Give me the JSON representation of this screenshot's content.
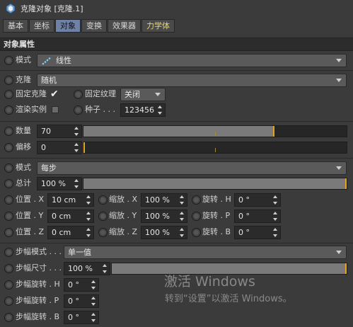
{
  "window": {
    "title": "克隆对象 [克隆.1]"
  },
  "tabs": [
    {
      "label": "基本"
    },
    {
      "label": "坐标"
    },
    {
      "label": "对象"
    },
    {
      "label": "变换"
    },
    {
      "label": "效果器"
    },
    {
      "label": "力学体"
    }
  ],
  "section_title": "对象属性",
  "mode": {
    "label": "模式",
    "value": "线性"
  },
  "clone": {
    "label": "克隆",
    "value": "随机"
  },
  "fixed_clone": {
    "label": "固定克隆",
    "checked": true
  },
  "fixed_texture": {
    "label": "固定纹理",
    "value": "关闭"
  },
  "render_instance": {
    "label": "渲染实例",
    "checked": false
  },
  "seed": {
    "label": "种子 . . .",
    "value": "123456"
  },
  "count": {
    "label": "数量",
    "value": "70",
    "fraction": 0.72
  },
  "offset": {
    "label": "偏移",
    "value": "0",
    "fraction": 0.0
  },
  "mode2": {
    "label": "模式",
    "value": "每步"
  },
  "total": {
    "label": "总计",
    "value": "100 %",
    "fraction": 1.0
  },
  "position": {
    "x": {
      "label": "位置 . X",
      "value": "10 cm"
    },
    "y": {
      "label": "位置 . Y",
      "value": "0 cm"
    },
    "z": {
      "label": "位置 . Z",
      "value": "0 cm"
    }
  },
  "scale": {
    "x": {
      "label": "缩放 . X",
      "value": "100 %"
    },
    "y": {
      "label": "缩放 . Y",
      "value": "100 %"
    },
    "z": {
      "label": "缩放 . Z",
      "value": "100 %"
    }
  },
  "rotation": {
    "h": {
      "label": "旋转 . H",
      "value": "0 °"
    },
    "p": {
      "label": "旋转 . P",
      "value": "0 °"
    },
    "b": {
      "label": "旋转 . B",
      "value": "0 °"
    }
  },
  "step_mode": {
    "label": "步幅模式 . . .",
    "value": "单一值"
  },
  "step_size": {
    "label": "步幅尺寸 . . .",
    "value": "100 %",
    "fraction": 1.0
  },
  "step_rotation": {
    "h": {
      "label": "步幅旋转 . H",
      "value": "0 °"
    },
    "p": {
      "label": "步幅旋转 . P",
      "value": "0 °"
    },
    "b": {
      "label": "步幅旋转 . B",
      "value": "0 °"
    }
  },
  "watermark": {
    "line1": "激活 Windows",
    "line2": "转到“设置”以激活 Windows。"
  },
  "colors": {
    "accent": "#e3a31c",
    "active_tab": "#6f82a6",
    "dynamics_tab": "#e9d56a"
  }
}
